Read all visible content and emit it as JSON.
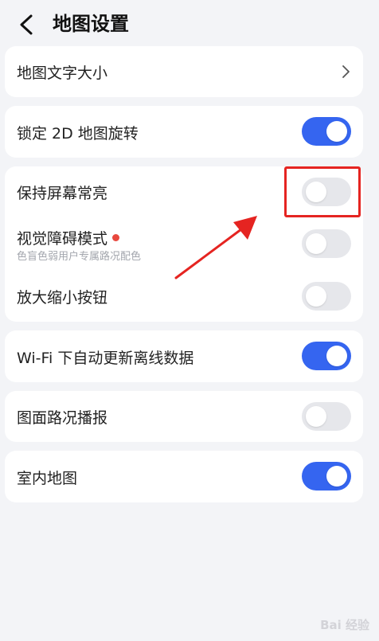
{
  "header": {
    "title": "地图设置",
    "back_icon": "chevron-left-icon"
  },
  "settings": {
    "map_text_size": {
      "label": "地图文字大小",
      "icon": "chevron-right-icon"
    },
    "lock_2d_rotation": {
      "label": "锁定 2D 地图旋转",
      "enabled": true
    },
    "keep_screen_on": {
      "label": "保持屏幕常亮",
      "enabled": false
    },
    "visual_impairment_mode": {
      "label": "视觉障碍模式",
      "sublabel": "色盲色弱用户专属路况配色",
      "enabled": false,
      "badge_color": "#e8483e"
    },
    "zoom_buttons": {
      "label": "放大缩小按钮",
      "enabled": false
    },
    "wifi_auto_update": {
      "label": "Wi-Fi 下自动更新离线数据",
      "enabled": true
    },
    "traffic_broadcast": {
      "label": "图面路况播报",
      "enabled": false
    },
    "indoor_map": {
      "label": "室内地图",
      "enabled": true
    }
  },
  "colors": {
    "toggle_on": "#3565f0",
    "toggle_off": "#e6e7eb",
    "annotation": "#e52421",
    "background": "#f3f4f7"
  },
  "watermark": "Bai 经验"
}
